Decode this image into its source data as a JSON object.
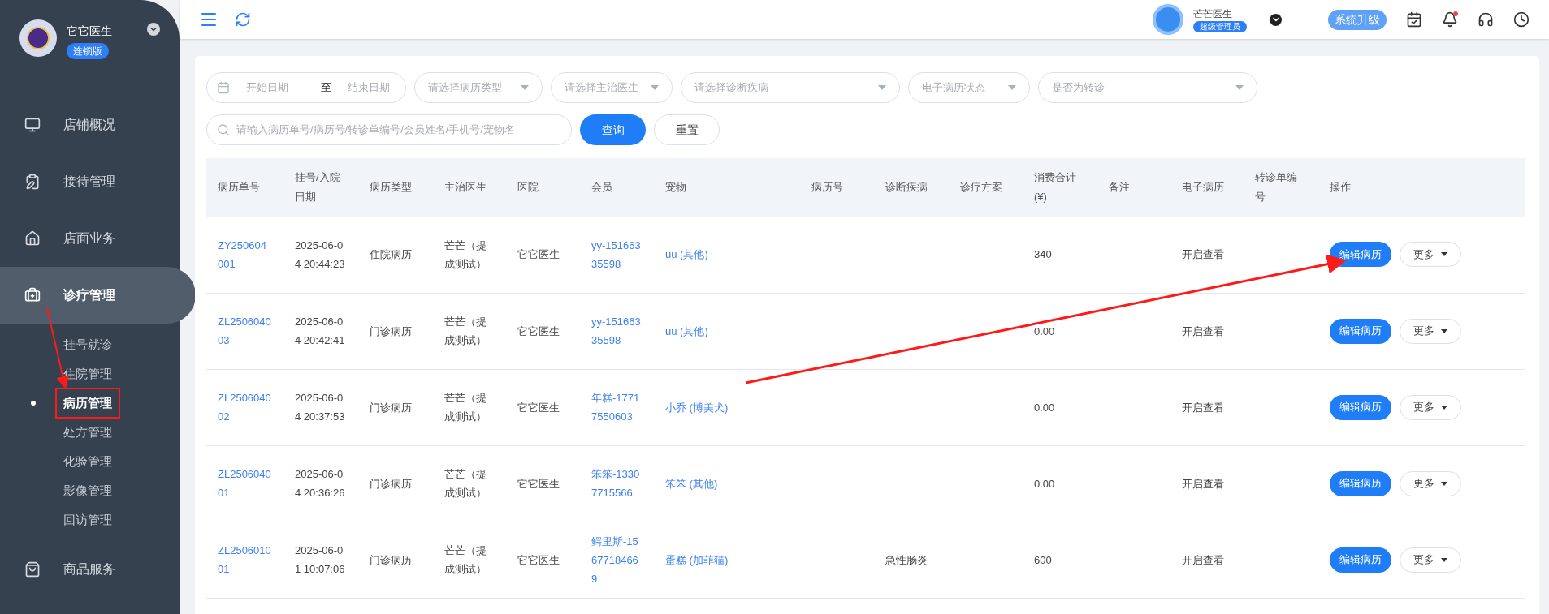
{
  "sidebar": {
    "brand": "它它医生",
    "edition": "连锁版",
    "items": [
      {
        "label": "店铺概况",
        "kind": "monitor",
        "selected": false
      },
      {
        "label": "接待管理",
        "kind": "clipboard",
        "selected": false
      },
      {
        "label": "店面业务",
        "kind": "house",
        "selected": false
      },
      {
        "label": "诊疗管理",
        "kind": "medkit",
        "selected": true,
        "children": [
          {
            "label": "挂号就诊",
            "selected": false,
            "annotated": false
          },
          {
            "label": "住院管理",
            "selected": false,
            "annotated": false
          },
          {
            "label": "病历管理",
            "selected": true,
            "annotated": true
          },
          {
            "label": "处方管理",
            "selected": false,
            "annotated": false
          },
          {
            "label": "化验管理",
            "selected": false,
            "annotated": false
          },
          {
            "label": "影像管理",
            "selected": false,
            "annotated": false
          },
          {
            "label": "回访管理",
            "selected": false,
            "annotated": false
          }
        ]
      },
      {
        "label": "商品服务",
        "kind": "bag",
        "selected": false
      }
    ]
  },
  "header": {
    "user_name": "芒芒医生",
    "user_role": "超级管理员",
    "upgrade_button": "系统升级",
    "notification_dot": true
  },
  "filters": {
    "start_date": {
      "placeholder": "开始日期"
    },
    "date_separator": "至",
    "end_date": {
      "placeholder": "结束日期"
    },
    "selects": [
      {
        "placeholder": "请选择病历类型"
      },
      {
        "placeholder": "请选择主治医生"
      },
      {
        "placeholder": "请选择诊断疾病"
      },
      {
        "placeholder": "电子病历状态"
      },
      {
        "placeholder": "是否为转诊"
      }
    ],
    "search": {
      "placeholder": "请输入病历单号/病历号/转诊单编号/会员姓名/手机号/宠物名"
    },
    "query_button": "查询",
    "reset_button": "重置"
  },
  "table": {
    "columns": [
      "病历单号",
      "挂号/入院日期",
      "病历类型",
      "主治医生",
      "医院",
      "会员",
      "宠物",
      "病历号",
      "诊断疾病",
      "诊疗方案",
      "消费合计(¥)",
      "备注",
      "电子病历",
      "转诊单编号",
      "操作"
    ],
    "rows": [
      {
        "record_id": "ZY250604001",
        "date": "2025-06-04 20:44:23",
        "type": "住院病历",
        "doctor": "芒芒（提成测试）",
        "hospital": "它它医生",
        "member": "yy-15166335598",
        "pet": "uu (其他)",
        "total": "340",
        "emr": "开启查看",
        "edit_button": "编辑病历",
        "more_button": "更多"
      },
      {
        "record_id": "ZL250604003",
        "date": "2025-06-04 20:42:41",
        "type": "门诊病历",
        "doctor": "芒芒（提成测试）",
        "hospital": "它它医生",
        "member": "yy-15166335598",
        "pet": "uu (其他)",
        "total": "0.00",
        "emr": "开启查看",
        "edit_button": "编辑病历",
        "more_button": "更多"
      },
      {
        "record_id": "ZL250604002",
        "date": "2025-06-04 20:37:53",
        "type": "门诊病历",
        "doctor": "芒芒（提成测试）",
        "hospital": "它它医生",
        "member": "年糕-17717550603",
        "pet": "小乔 (博美犬)",
        "total": "0.00",
        "emr": "开启查看",
        "edit_button": "编辑病历",
        "more_button": "更多"
      },
      {
        "record_id": "ZL250604001",
        "date": "2025-06-04 20:36:26",
        "type": "门诊病历",
        "doctor": "芒芒（提成测试）",
        "hospital": "它它医生",
        "member": "笨笨-13307715566",
        "pet": "笨笨 (其他)",
        "total": "0.00",
        "emr": "开启查看",
        "edit_button": "编辑病历",
        "more_button": "更多"
      },
      {
        "record_id": "ZL250601001",
        "date": "2025-06-01 10:07:06",
        "type": "门诊病历",
        "doctor": "芒芒（提成测试）",
        "hospital": "它它医生",
        "member": "鳄里斯-15677184669",
        "pet": "蛋糕 (加菲猫)",
        "diagnosis": "急性肠炎",
        "total": "600",
        "emr": "开启查看",
        "edit_button": "编辑病历",
        "more_button": "更多"
      }
    ]
  }
}
